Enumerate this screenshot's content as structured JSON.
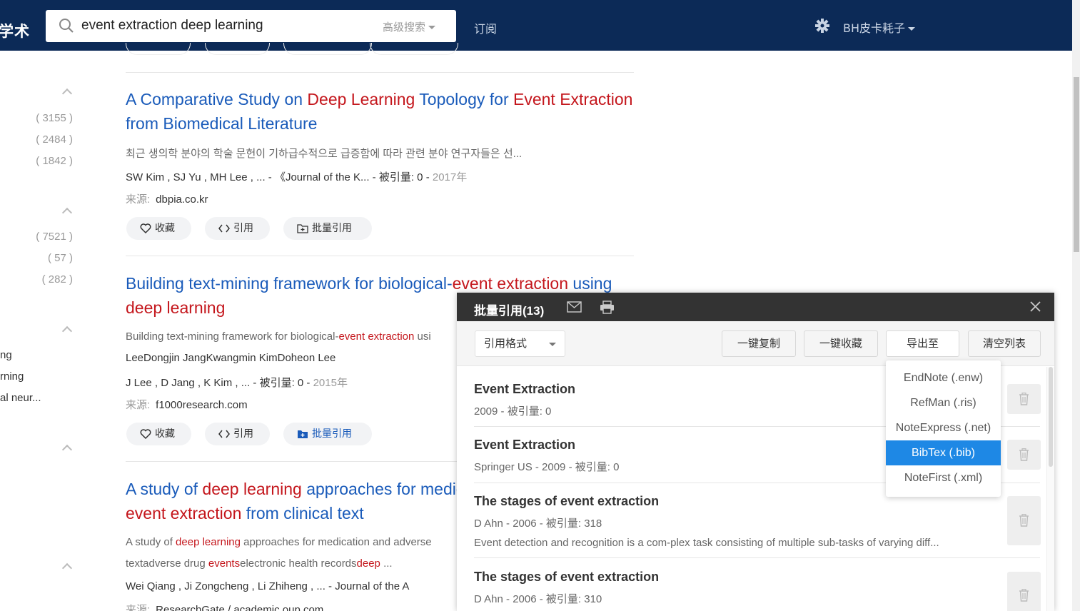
{
  "header": {
    "logo": "学术",
    "search_value": "event extraction deep learning",
    "advanced_search": "高级搜索",
    "subscribe": "订阅",
    "username": "BH皮卡耗子"
  },
  "filters": {
    "counts": [
      "( 3155 )",
      "( 2484 )",
      "( 1842 )",
      "( 7521 )",
      "( 57 )",
      "( 282 )"
    ],
    "keywords": [
      "ng",
      "rning",
      "al neur..."
    ]
  },
  "results": [
    {
      "title_parts": [
        "A Comparative Study on ",
        "Deep Learning",
        " Topology for ",
        "Event Extraction"
      ],
      "title_line2": "from Biomedical Literature",
      "abstract": "최근 생의학 분야의 학술 문헌이 기하급수적으로 급증함에 따라 관련 분야 연구자들은 선...",
      "authors": "SW Kim ,   SJ Yu ,   MH Lee ,   ... -  《Journal of the K...  -  被引量:  0  -",
      "year": "2017年",
      "source_label": "来源:",
      "source": "dbpia.co.kr",
      "btn_fav": "收藏",
      "btn_cite": "引用",
      "btn_batch": "批量引用"
    },
    {
      "title_parts": [
        "Building text-mining framework for biological-",
        "event extraction",
        " using"
      ],
      "title_line2": "deep learning",
      "abstract_parts": [
        "Building text-mining framework for biological-",
        "event extraction",
        " usi"
      ],
      "keywords": "LeeDongjin JangKwangmin KimDoheon Lee",
      "authors": "J Lee ,   D Jang ,   K Kim ,   ... -  被引量:  0  -",
      "year": "2015年",
      "source_label": "来源:",
      "source": "f1000research.com",
      "btn_fav": "收藏",
      "btn_cite": "引用",
      "btn_batch": "批量引用"
    },
    {
      "title_parts": [
        "A study of ",
        "deep learning",
        " approaches for medic"
      ],
      "title_line2_parts": [
        "event extraction",
        " from clinical text"
      ],
      "abstract_parts": [
        "A study of ",
        "deep learning",
        " approaches for medication and adverse"
      ],
      "abstract2_parts": [
        "textadverse drug ",
        "events",
        "electronic health records",
        "deep",
        " ..."
      ],
      "authors": "Wei Qiang ,   Ji Zongcheng ,   Li Zhiheng ,   ... -  Journal of the A",
      "source_label": "来源:",
      "source": "ResearchGate  /  academic.oup.com"
    }
  ],
  "panel": {
    "title": "批量引用(13)",
    "format_select": "引用格式",
    "btn_copy": "一键复制",
    "btn_collect": "一键收藏",
    "btn_export": "导出至",
    "btn_clear": "清空列表",
    "items": [
      {
        "title": "Event Extraction",
        "meta": "2009 - 被引量: 0"
      },
      {
        "title": "Event Extraction",
        "meta": "Springer US - 2009 - 被引量: 0"
      },
      {
        "title": "The stages of event extraction",
        "meta": "D Ahn  - 2006 - 被引量: 318",
        "abstract": "Event detection and recognition is a com-plex task consisting of multiple sub-tasks of varying diff..."
      },
      {
        "title": "The stages of event extraction",
        "meta": "D Ahn  - 2006 - 被引量: 310"
      }
    ]
  },
  "export_menu": {
    "options": [
      "EndNote (.enw)",
      "RefMan (.ris)",
      "NoteExpress (.net)",
      "BibTex (.bib)",
      "NoteFirst (.xml)"
    ],
    "selected": "BibTex (.bib)"
  },
  "colors": {
    "header_bg": "#0c2a57",
    "link_blue": "#1a5bba",
    "highlight_red": "#c4161c",
    "selected_blue": "#1e88e5"
  }
}
